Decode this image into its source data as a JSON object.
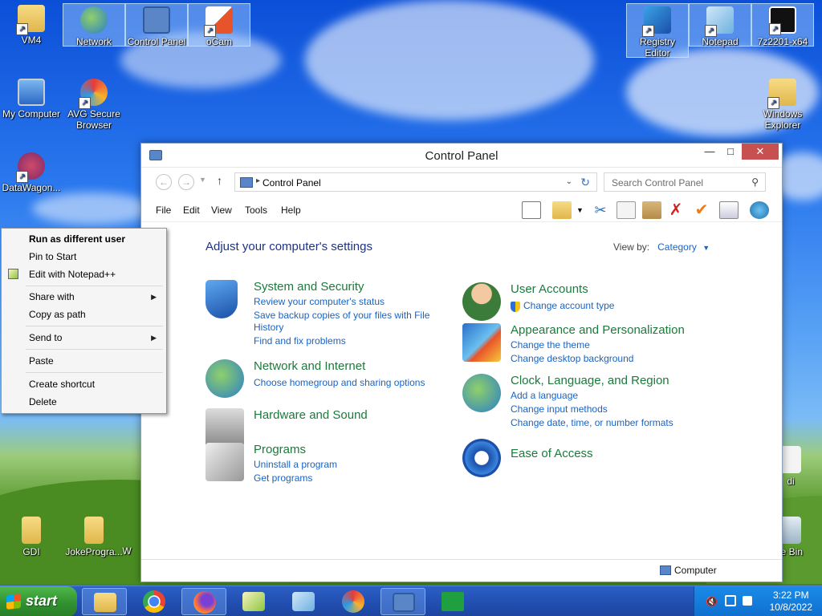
{
  "desktop": {
    "top_icons": [
      {
        "label": "VM4"
      },
      {
        "label": "Network"
      },
      {
        "label": "Control Panel"
      },
      {
        "label": "oCam"
      }
    ],
    "top_right_icons": [
      {
        "label": "Registry Editor"
      },
      {
        "label": "Notepad"
      },
      {
        "label": "7z2201-x64"
      }
    ],
    "left_icons": [
      {
        "label": "My Computer"
      },
      {
        "label": "AVG Secure Browser"
      },
      {
        "label": "DataWagon..."
      }
    ],
    "right_icons": [
      {
        "label": "Windows Explorer"
      },
      {
        "label": "di"
      },
      {
        "label": "le Bin"
      }
    ],
    "bottom_icons": [
      {
        "label": "GDI"
      },
      {
        "label": "JokeProgra..."
      },
      {
        "label": "W"
      }
    ]
  },
  "context_menu": {
    "items": [
      {
        "label": "Run as different user",
        "bold": true
      },
      {
        "label": "Pin to Start"
      },
      {
        "label": "Edit with Notepad++"
      },
      {
        "label": "Share with"
      },
      {
        "label": "Copy as path"
      },
      {
        "label": "Send to"
      },
      {
        "label": "Paste"
      },
      {
        "label": "Create shortcut"
      },
      {
        "label": "Delete"
      }
    ]
  },
  "window": {
    "title": "Control Panel",
    "address": {
      "crumb": "Control Panel"
    },
    "search": {
      "placeholder": "Search Control Panel"
    },
    "menu": [
      "File",
      "Edit",
      "View",
      "Tools",
      "Help"
    ],
    "heading": "Adjust your computer's settings",
    "view_by": {
      "label": "View by:",
      "value": "Category"
    },
    "categories_left": [
      {
        "title": "System and Security",
        "links": [
          "Review your computer's status",
          "Save backup copies of your files with File",
          "History",
          "Find and fix problems"
        ]
      },
      {
        "title": "Network and Internet",
        "links": [
          "Choose homegroup and sharing options"
        ]
      },
      {
        "title": "Hardware and Sound",
        "links": []
      },
      {
        "title": "Programs",
        "links": [
          "Uninstall a program",
          "Get programs"
        ]
      }
    ],
    "categories_right": [
      {
        "title": "User Accounts",
        "links": [
          "Change account type"
        ]
      },
      {
        "title": "Appearance and Personalization",
        "links": [
          "Change the theme",
          "Change desktop background"
        ]
      },
      {
        "title": "Clock, Language, and Region",
        "links": [
          "Add a language",
          "Change input methods",
          "Change date, time, or number formats"
        ]
      },
      {
        "title": "Ease of Access",
        "links": []
      }
    ],
    "status": "Computer"
  },
  "taskbar": {
    "start_label": "start",
    "clock_time": "3:22 PM",
    "clock_date": "10/8/2022"
  }
}
